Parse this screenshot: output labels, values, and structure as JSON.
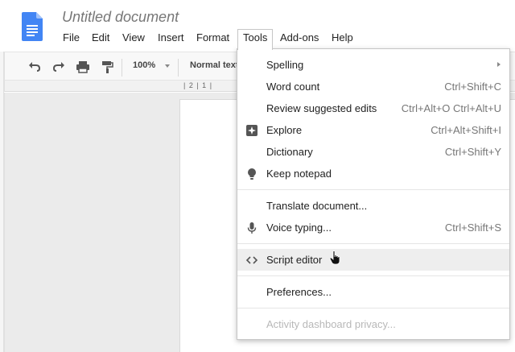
{
  "document": {
    "title": "Untitled document"
  },
  "menubar": {
    "items": [
      "File",
      "Edit",
      "View",
      "Insert",
      "Format",
      "Tools",
      "Add-ons",
      "Help"
    ],
    "active": "Tools"
  },
  "toolbar": {
    "zoom": "100%",
    "style": "Normal text",
    "icons": [
      "undo-icon",
      "redo-icon",
      "print-icon",
      "paint-format-icon"
    ]
  },
  "ruler": {
    "text": "| 2 | 1 |"
  },
  "tools_menu": {
    "groups": [
      [
        {
          "label": "Spelling",
          "shortcut": "",
          "icon": "",
          "submenu": true
        },
        {
          "label": "Word count",
          "shortcut": "Ctrl+Shift+C",
          "icon": ""
        },
        {
          "label": "Review suggested edits",
          "shortcut": "Ctrl+Alt+O Ctrl+Alt+U",
          "icon": ""
        },
        {
          "label": "Explore",
          "shortcut": "Ctrl+Alt+Shift+I",
          "icon": "explore-icon"
        },
        {
          "label": "Dictionary",
          "shortcut": "Ctrl+Shift+Y",
          "icon": ""
        },
        {
          "label": "Keep notepad",
          "shortcut": "",
          "icon": "lightbulb-icon"
        }
      ],
      [
        {
          "label": "Translate document...",
          "shortcut": "",
          "icon": ""
        },
        {
          "label": "Voice typing...",
          "shortcut": "Ctrl+Shift+S",
          "icon": "microphone-icon"
        }
      ],
      [
        {
          "label": "Script editor",
          "shortcut": "",
          "icon": "code-icon",
          "hover": true
        }
      ],
      [
        {
          "label": "Preferences...",
          "shortcut": "",
          "icon": ""
        }
      ],
      [
        {
          "label": "Activity dashboard privacy...",
          "shortcut": "",
          "icon": "",
          "disabled": true
        }
      ]
    ]
  },
  "colors": {
    "docs_blue": "#4285f4",
    "menu_hover": "#eeeeee",
    "disabled_text": "#b8b8b8"
  }
}
